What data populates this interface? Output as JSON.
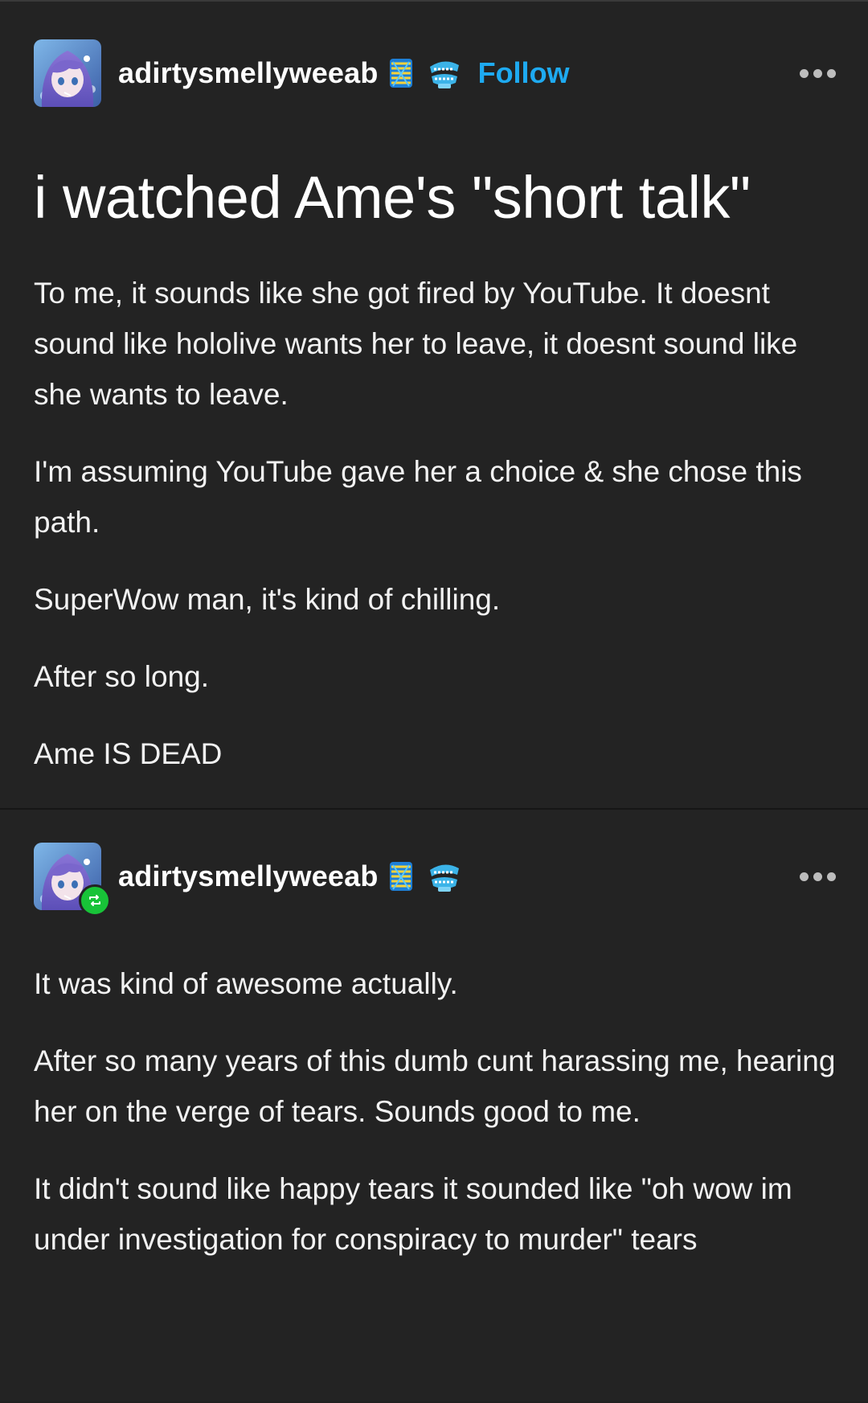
{
  "original_post": {
    "username": "adirtysmellyweeab",
    "follow_label": "Follow",
    "title": "i watched Ame's \"short talk\"",
    "paragraphs": [
      "To me, it sounds like she got fired by YouTube. It doesnt sound like hololive wants her to leave, it doesnt sound like she wants to leave.",
      "I'm assuming YouTube gave her a choice & she chose this path.",
      "SuperWow man, it's kind of chilling.",
      "After so long.",
      "Ame IS DEAD"
    ],
    "badges": [
      "spring-badge-icon",
      "chattering-teeth-icon"
    ]
  },
  "reblog": {
    "username": "adirtysmellyweeab",
    "paragraphs": [
      "It was kind of awesome actually.",
      "After so many years of this dumb cunt harassing me, hearing her on the verge of tears. Sounds good to me.",
      "It didn't sound like happy tears it sounded like \"oh wow im under investigation for conspiracy to murder\" tears"
    ],
    "badges": [
      "spring-badge-icon",
      "chattering-teeth-icon"
    ]
  },
  "colors": {
    "background": "#232323",
    "text": "#f2f2f2",
    "follow": "#1eaaf1",
    "reblog_badge": "#18c338"
  }
}
